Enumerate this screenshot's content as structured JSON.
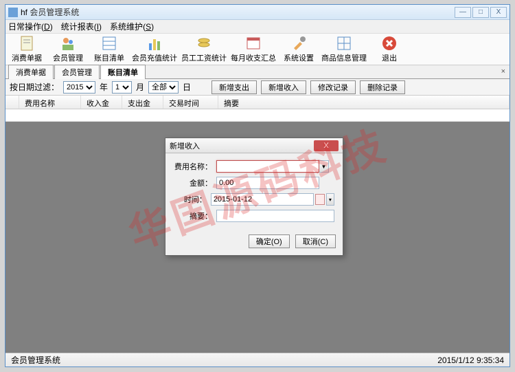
{
  "window": {
    "app_prefix": "hf",
    "title": "会员管理系统"
  },
  "win_controls": {
    "min": "—",
    "max": "□",
    "close": "X"
  },
  "menubar": [
    {
      "label": "日常操作",
      "accel": "D"
    },
    {
      "label": "统计报表",
      "accel": "I"
    },
    {
      "label": "系统维护",
      "accel": "S"
    }
  ],
  "toolbar": [
    {
      "label": "消费单据",
      "name": "consume-bill"
    },
    {
      "label": "会员管理",
      "name": "member-mgmt"
    },
    {
      "label": "账目清单",
      "name": "account-list"
    },
    {
      "label": "会员充值统计",
      "name": "recharge-stats"
    },
    {
      "label": "员工工资统计",
      "name": "salary-stats"
    },
    {
      "label": "每月收支汇总",
      "name": "monthly-summary"
    },
    {
      "label": "系统设置",
      "name": "settings"
    },
    {
      "label": "商品信息管理",
      "name": "product-mgmt"
    },
    {
      "label": "退出",
      "name": "exit"
    }
  ],
  "tabs": [
    {
      "label": "消费单据",
      "active": false
    },
    {
      "label": "会员管理",
      "active": false
    },
    {
      "label": "账目清单",
      "active": true
    }
  ],
  "tabs_close": "×",
  "filter": {
    "label": "按日期过滤：",
    "year": "2015",
    "year_suffix": "年",
    "month": "1",
    "month_suffix": "月",
    "scope": "全部",
    "day_suffix": "日",
    "btn_new_expense": "新增支出",
    "btn_new_income": "新增收入",
    "btn_modify": "修改记录",
    "btn_delete": "删除记录"
  },
  "grid_headers": [
    "费用名称",
    "收入金额",
    "支出金额",
    "交易时间",
    "摘要"
  ],
  "dialog": {
    "title": "新增收入",
    "fields": {
      "name_label": "费用名称：",
      "name_value": "",
      "amount_label": "金额：",
      "amount_value": "0.00",
      "time_label": "时间：",
      "time_value": "2015-01-12",
      "summary_label": "摘要：",
      "summary_value": ""
    },
    "ok": "确定(O)",
    "cancel": "取消(C)",
    "close": "X"
  },
  "statusbar": {
    "left": "会员管理系统",
    "right": "2015/1/12 9:35:34"
  },
  "watermark": "华国源码科技"
}
